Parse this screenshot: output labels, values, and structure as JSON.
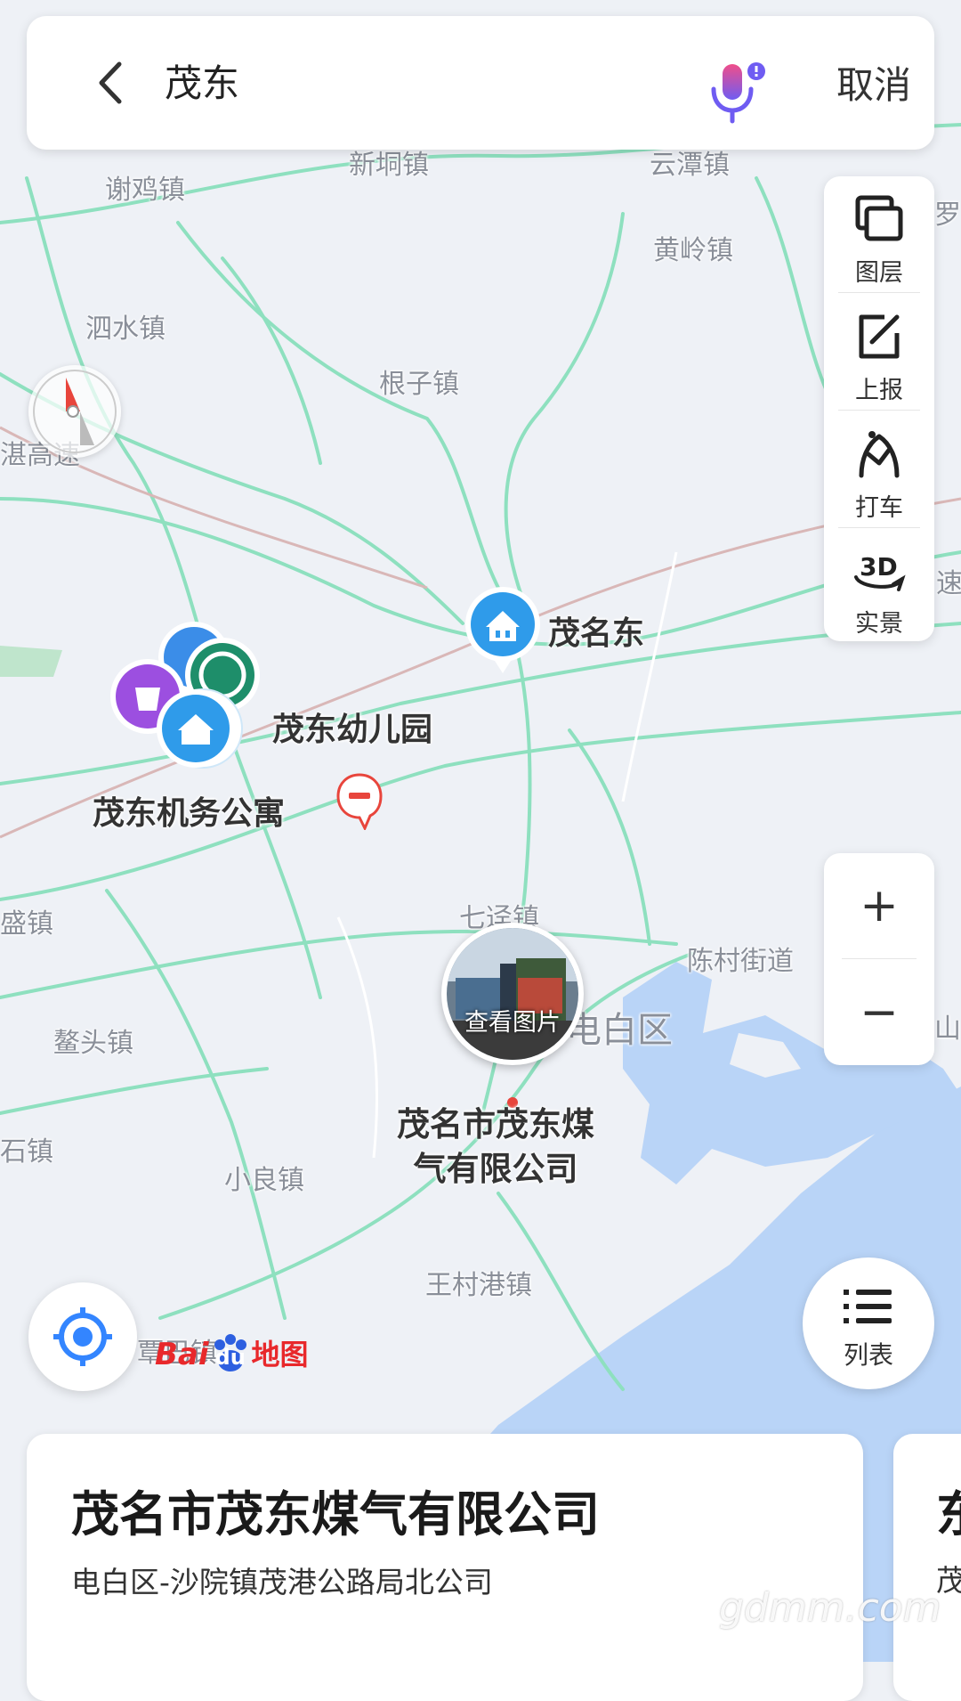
{
  "search": {
    "query": "茂东",
    "cancel_label": "取消"
  },
  "tools": [
    {
      "label": "图层",
      "icon": "layers-icon"
    },
    {
      "label": "上报",
      "icon": "report-icon"
    },
    {
      "label": "打车",
      "icon": "taxi-icon"
    },
    {
      "label": "实景",
      "icon": "3d-icon"
    }
  ],
  "zoom": {
    "in": "+",
    "out": "−"
  },
  "list_button": {
    "label": "列表"
  },
  "map_labels": {
    "xintong": "新垌镇",
    "yuntan": "云潭镇",
    "xieji": "谢鸡镇",
    "huangling": "黄岭镇",
    "sishui": "泗水镇",
    "genzi": "根子镇",
    "gaosu": "湛高速",
    "sheng": "盛镇",
    "qijing": "七迳镇",
    "chencun": "陈村街道",
    "dianbai": "电白区",
    "aotou": "鳌头镇",
    "shishi": "石镇",
    "xiaoliang": "小良镇",
    "wangcun": "王村港镇",
    "jiaba": "覃巴镇",
    "su": "速",
    "luo": "罗",
    "shan": "山"
  },
  "pois": {
    "maoming_east": "茂名东",
    "kindergarten": "茂东幼儿园",
    "apartment": "茂东机务公寓",
    "gas_company": "茂名市茂东煤\n气有限公司"
  },
  "photo_pin": {
    "label": "查看图片"
  },
  "logo": {
    "text1": "Bai",
    "text2": "du",
    "text3": "地图"
  },
  "card": {
    "title": "茂名市茂东煤气有限公司",
    "address": "电白区-沙院镇茂港公路局北公司"
  },
  "card2": {
    "title": "东",
    "sub": "茂"
  },
  "watermark": "gdmm.com",
  "colors": {
    "road": "#7fd9b4",
    "water": "#b9d4f7",
    "land": "#eef1f6",
    "accent": "#3385ff"
  }
}
